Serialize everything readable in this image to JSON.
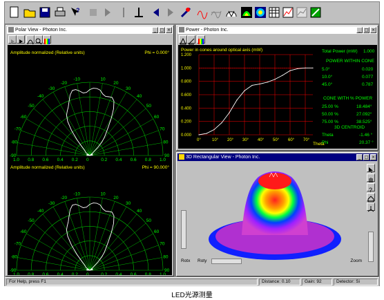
{
  "statusbar": {
    "help": "For Help, press F1",
    "distance": "Distance: 0.10",
    "gain": "Gain: 92",
    "detector": "Detector: Si"
  },
  "caption": "LED光源测量",
  "polar": {
    "title": "Polar View - Photon Inc.",
    "top": {
      "label": "Amplitude normalized (Relative units)",
      "phi": "Phi = 0.000°"
    },
    "bottom": {
      "label": "Amplitude normalized (Relative units)",
      "phi": "Phi = 90.000°"
    },
    "angles": [
      "-10",
      "10",
      "-20",
      "20",
      "-30",
      "30",
      "-40",
      "40",
      "-50",
      "50",
      "-60",
      "60",
      "-70",
      "70",
      "-80",
      "80",
      "-90",
      "90"
    ],
    "radial_ticks": [
      "1.0",
      "0.8",
      "0.6",
      "0.4",
      "0.2",
      "0",
      "0.2",
      "0.4",
      "0.6",
      "0.8",
      "1.0"
    ]
  },
  "power": {
    "title": "Power - Photon Inc.",
    "chart_title": "Power in cones around optical axis (mW)",
    "ylabel_ticks": [
      "1.200",
      "1.000",
      "0.800",
      "0.600",
      "0.400",
      "0.200",
      "0.000"
    ],
    "xlabel_ticks": [
      "0°",
      "10°",
      "20°",
      "30°",
      "40°",
      "50°",
      "60°",
      "70°"
    ],
    "xlabel": "Theta",
    "total_label": "Total Power (mW)",
    "total_value": "1.000",
    "within_cone_header": "POWER WITHIN CONE",
    "within_cone": [
      {
        "k": "5.0°",
        "v": "0.020"
      },
      {
        "k": "10.0°",
        "v": "0.077"
      },
      {
        "k": "45.0°",
        "v": "0.787"
      }
    ],
    "pct_header": "CONE WITH % POWER",
    "pct": [
      {
        "k": "25.00 %",
        "v": "18.484°"
      },
      {
        "k": "50.00 %",
        "v": "27.092°"
      },
      {
        "k": "75.00 %",
        "v": "38.525°"
      }
    ],
    "centroid_header": "3D CENTROID",
    "centroid": [
      {
        "k": "Theta",
        "v": "-1.46 °"
      },
      {
        "k": "Phi",
        "v": "20.37 °"
      }
    ]
  },
  "rect3d": {
    "title": "3D Rectangular View - Photon Inc.",
    "rotx": "Rotx",
    "roty": "Roty",
    "zoom": "Zoom"
  },
  "chart_data": {
    "type": "line",
    "title": "Power in cones around optical axis (mW)",
    "xlabel": "Theta",
    "ylabel": "",
    "x": [
      0,
      5,
      10,
      15,
      20,
      25,
      30,
      35,
      40,
      45,
      50,
      55,
      60,
      65,
      70,
      75
    ],
    "values": [
      0,
      0.02,
      0.077,
      0.18,
      0.33,
      0.52,
      0.66,
      0.74,
      0.76,
      0.787,
      0.83,
      0.89,
      0.96,
      0.99,
      1.0,
      1.0
    ],
    "xlim": [
      0,
      75
    ],
    "ylim": [
      0,
      1.2
    ],
    "colors": {
      "line": "#ffffff",
      "grid": "#ff0000",
      "ticks": "#ffff00"
    }
  }
}
